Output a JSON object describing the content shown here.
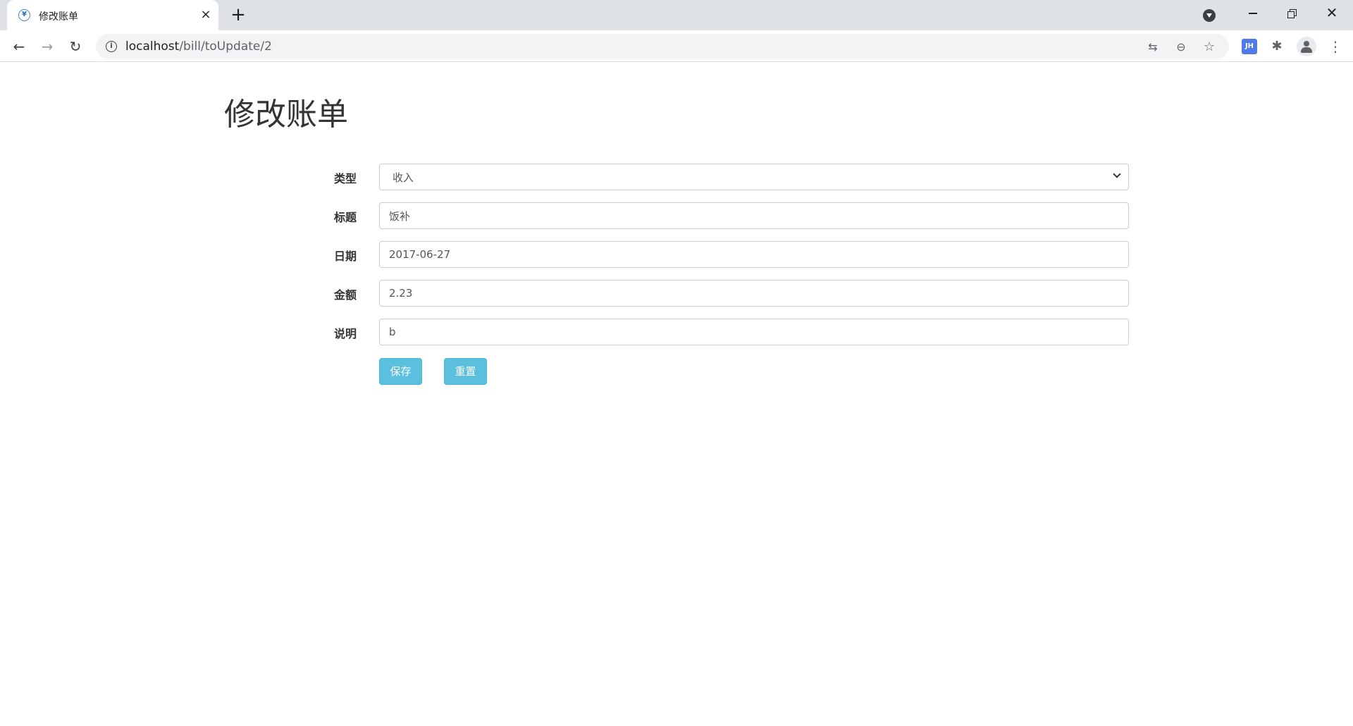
{
  "browser": {
    "tab_title": "修改账单",
    "tab_favicon": "¥",
    "tab_close": "×",
    "new_tab": "+",
    "url_host": "localhost",
    "url_path": "/bill/toUpdate/2",
    "ext_jh": "JH",
    "icons": [
      "back-arrow-icon",
      "forward-arrow-icon",
      "reload-icon",
      "info-icon",
      "translate-icon",
      "zoom-out-icon",
      "star-icon",
      "puzzle-icon",
      "avatar-icon",
      "menu-icon"
    ]
  },
  "page": {
    "title": "修改账单"
  },
  "form": {
    "type": {
      "label": "类型",
      "value": "收入"
    },
    "title": {
      "label": "标题",
      "value": "饭补"
    },
    "date": {
      "label": "日期",
      "value": "2017-06-27"
    },
    "amount": {
      "label": "金额",
      "value": "2.23"
    },
    "note": {
      "label": "说明",
      "value": "b"
    },
    "save_label": "保存",
    "reset_label": "重置"
  },
  "colors": {
    "button_bg": "#5bc0de",
    "tabstrip_bg": "#dee1e6"
  }
}
